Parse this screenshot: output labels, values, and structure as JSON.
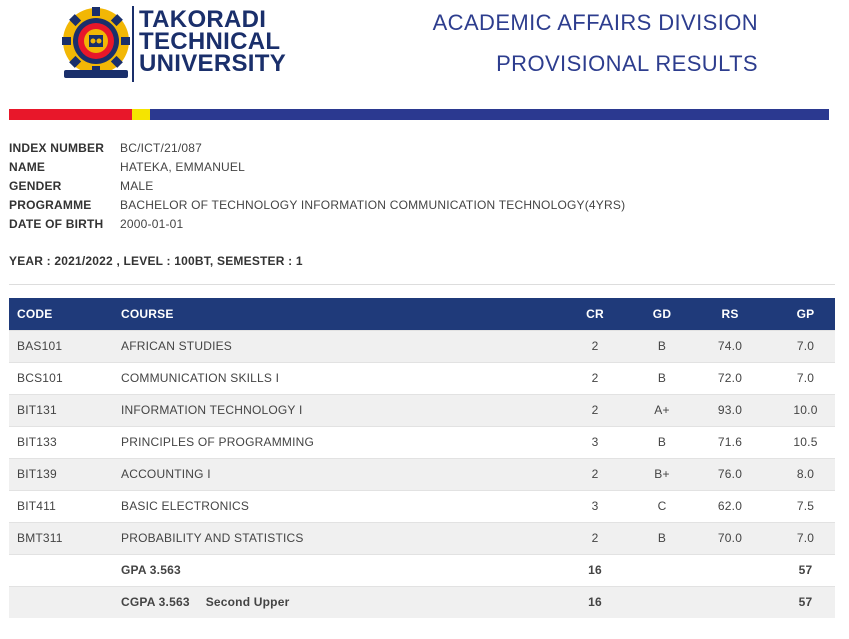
{
  "header": {
    "logo_lines": [
      "TAKORADI",
      "TECHNICAL",
      "UNIVERSITY"
    ],
    "division": "ACADEMIC AFFAIRS DIVISION",
    "subtitle": "PROVISIONAL RESULTS",
    "colors": {
      "red": "#e8172a",
      "yellow": "#f5e400",
      "blue": "#2b3990",
      "navy": "#1a2f6b"
    }
  },
  "student": {
    "fields": [
      {
        "label": "INDEX NUMBER",
        "value": "BC/ICT/21/087"
      },
      {
        "label": "NAME",
        "value": "HATEKA, EMMANUEL"
      },
      {
        "label": "GENDER",
        "value": "MALE"
      },
      {
        "label": "PROGRAMME",
        "value": "BACHELOR OF TECHNOLOGY INFORMATION COMMUNICATION TECHNOLOGY(4YRS)"
      },
      {
        "label": "DATE OF BIRTH",
        "value": "2000-01-01"
      }
    ]
  },
  "period": "YEAR : 2021/2022 , LEVEL : 100BT, SEMESTER : 1",
  "table": {
    "headers": [
      "CODE",
      "COURSE",
      "CR",
      "GD",
      "RS",
      "GP"
    ],
    "rows": [
      [
        "BAS101",
        "AFRICAN STUDIES",
        "2",
        "B",
        "74.0",
        "7.0"
      ],
      [
        "BCS101",
        "COMMUNICATION SKILLS I",
        "2",
        "B",
        "72.0",
        "7.0"
      ],
      [
        "BIT131",
        "INFORMATION TECHNOLOGY I",
        "2",
        "A+",
        "93.0",
        "10.0"
      ],
      [
        "BIT133",
        "PRINCIPLES OF PROGRAMMING",
        "3",
        "B",
        "71.6",
        "10.5"
      ],
      [
        "BIT139",
        "ACCOUNTING I",
        "2",
        "B+",
        "76.0",
        "8.0"
      ],
      [
        "BIT411",
        "BASIC ELECTRONICS",
        "3",
        "C",
        "62.0",
        "7.5"
      ],
      [
        "BMT311",
        "PROBABILITY AND STATISTICS",
        "2",
        "B",
        "70.0",
        "7.0"
      ]
    ],
    "gpa": {
      "label": "GPA 3.563",
      "cr": "16",
      "gp": "57"
    },
    "cgpa": {
      "label": "CGPA 3.563",
      "standing": "Second Upper",
      "cr": "16",
      "gp": "57"
    }
  }
}
